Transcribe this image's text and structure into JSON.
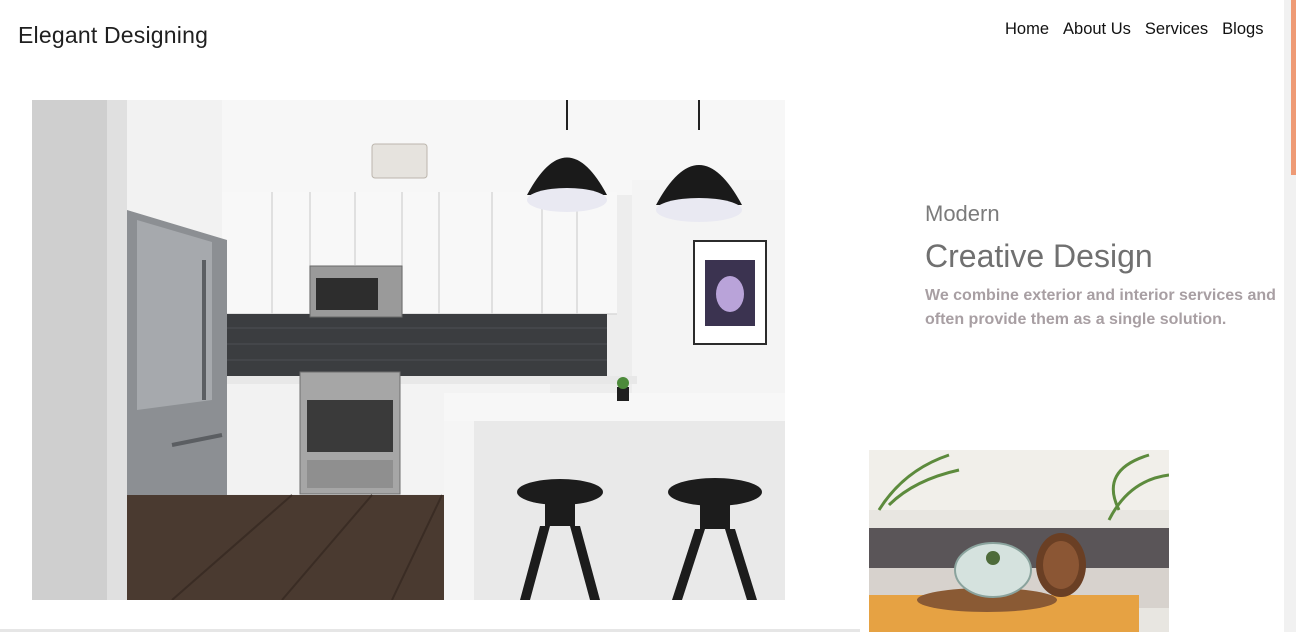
{
  "header": {
    "brand": "Elegant Designing",
    "nav": [
      "Home",
      "About Us",
      "Services",
      "Blogs"
    ]
  },
  "hero": {
    "eyebrow": "Modern",
    "headline": "Creative Design",
    "description": "We combine exterior and interior services and often provide them as a single solution."
  },
  "colors": {
    "accent_scrollbar": "#ee9a75",
    "description_text": "#a89fa3",
    "heading_text": "#707070"
  }
}
